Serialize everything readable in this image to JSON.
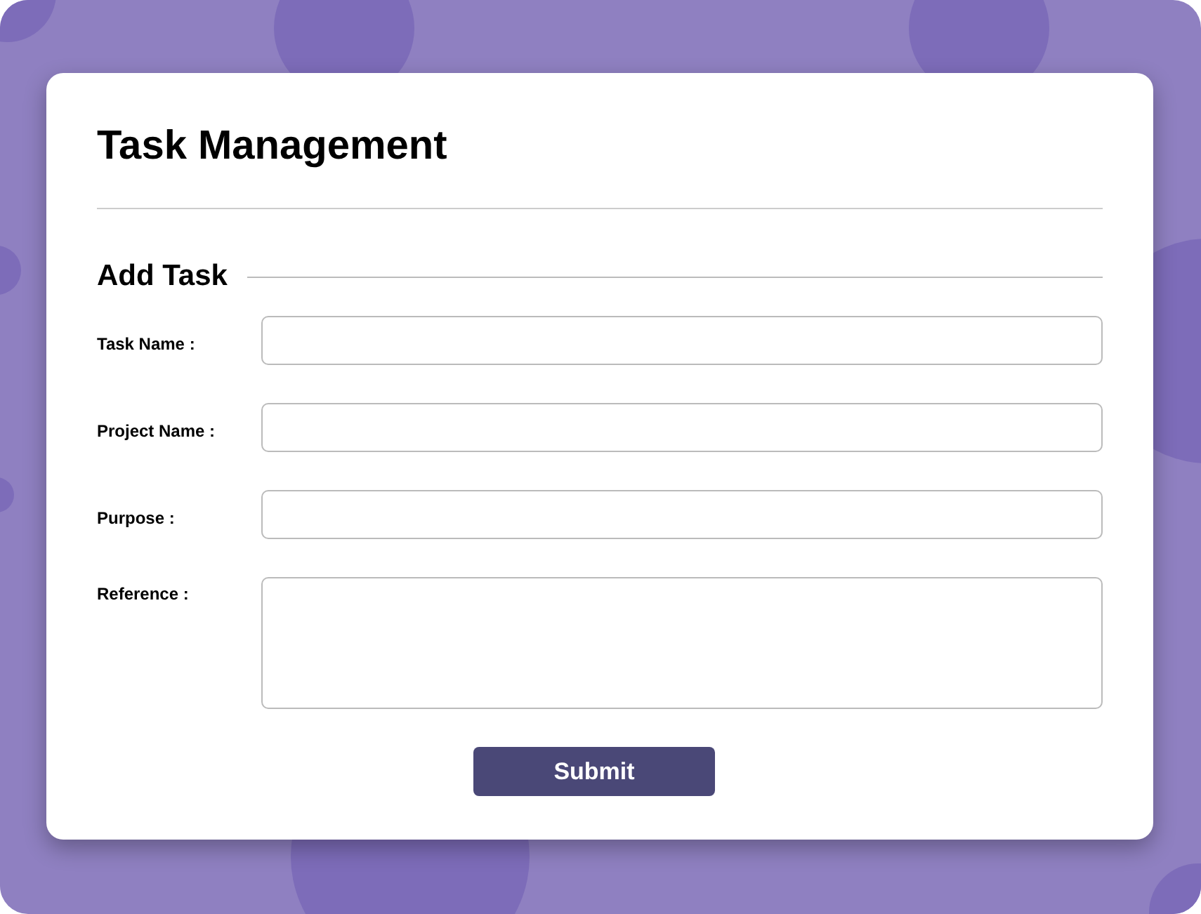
{
  "title": "Task Management",
  "section": {
    "title": "Add Task"
  },
  "fields": [
    {
      "label": "Task Name :",
      "kind": "input"
    },
    {
      "label": "Project Name :",
      "kind": "input"
    },
    {
      "label": "Purpose :",
      "kind": "input"
    },
    {
      "label": "Reference :",
      "kind": "textarea"
    }
  ],
  "submit_button": "Submit"
}
